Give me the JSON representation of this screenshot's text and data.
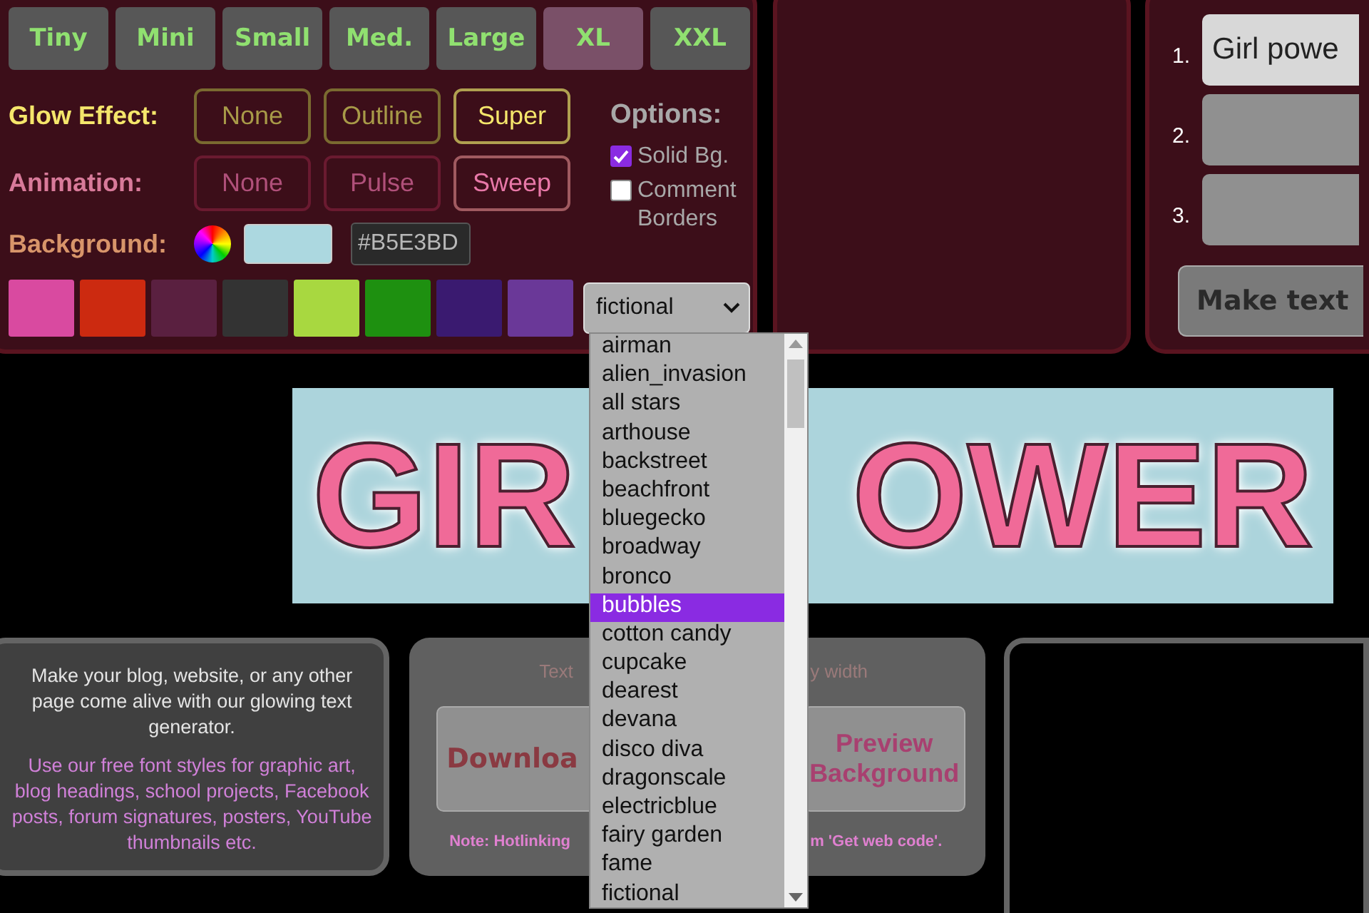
{
  "size_buttons": [
    {
      "label": "Tiny",
      "selected": false
    },
    {
      "label": "Mini",
      "selected": false
    },
    {
      "label": "Small",
      "selected": false
    },
    {
      "label": "Med.",
      "selected": false
    },
    {
      "label": "Large",
      "selected": false
    },
    {
      "label": "XL",
      "selected": true
    },
    {
      "label": "XXL",
      "selected": false
    }
  ],
  "glow_effect": {
    "label": "Glow Effect:",
    "options": [
      {
        "label": "None",
        "selected": false
      },
      {
        "label": "Outline",
        "selected": false
      },
      {
        "label": "Super",
        "selected": true
      }
    ]
  },
  "animation": {
    "label": "Animation:",
    "options": [
      {
        "label": "None",
        "selected": false
      },
      {
        "label": "Pulse",
        "selected": false
      },
      {
        "label": "Sweep",
        "selected": true
      }
    ]
  },
  "background": {
    "label": "Background:",
    "color": "#acd8e0",
    "hex_value": "#B5E3BD"
  },
  "options": {
    "label": "Options:",
    "items": [
      {
        "label": "Solid Bg.",
        "checked": true
      },
      {
        "label": "Comment Borders",
        "checked": false
      }
    ]
  },
  "swatches": [
    {
      "color": "#d94aa0"
    },
    {
      "color": "#cc2a10"
    },
    {
      "color": "#5a2040"
    },
    {
      "color": "#333333"
    },
    {
      "color": "#a8d840"
    },
    {
      "color": "#1e9010"
    },
    {
      "color": "#3a1a70"
    },
    {
      "color": "#6a3898"
    }
  ],
  "font_select": {
    "value": "fictional",
    "options": [
      {
        "label": "airman",
        "highlighted": false
      },
      {
        "label": "alien_invasion",
        "highlighted": false
      },
      {
        "label": "all stars",
        "highlighted": false
      },
      {
        "label": "arthouse",
        "highlighted": false
      },
      {
        "label": "backstreet",
        "highlighted": false
      },
      {
        "label": "beachfront",
        "highlighted": false
      },
      {
        "label": "bluegecko",
        "highlighted": false
      },
      {
        "label": "broadway",
        "highlighted": false
      },
      {
        "label": "bronco",
        "highlighted": false
      },
      {
        "label": "bubbles",
        "highlighted": true
      },
      {
        "label": "cotton candy",
        "highlighted": false
      },
      {
        "label": "cupcake",
        "highlighted": false
      },
      {
        "label": "dearest",
        "highlighted": false
      },
      {
        "label": "devana",
        "highlighted": false
      },
      {
        "label": "disco diva",
        "highlighted": false
      },
      {
        "label": "dragonscale",
        "highlighted": false
      },
      {
        "label": "electricblue",
        "highlighted": false
      },
      {
        "label": "fairy garden",
        "highlighted": false
      },
      {
        "label": "fame",
        "highlighted": false
      },
      {
        "label": "fictional",
        "highlighted": false
      }
    ]
  },
  "text_lines": [
    {
      "number": "1.",
      "value": "Girl powe"
    },
    {
      "number": "2."
    },
    {
      "number": "3."
    }
  ],
  "make_text_button": "Make text",
  "banner": {
    "left_text": "GIR",
    "right_text": "OWER"
  },
  "intro": {
    "paragraph_1": "Make your blog, website, or any other page come alive with our glowing text generator.",
    "paragraph_2": "Use our free font styles for graphic art, blog headings, school projects, Facebook posts, forum signatures, posters, YouTube thumbnails etc."
  },
  "download_panel": {
    "caption_left": "Text",
    "caption_right": "y width",
    "download_button": "Downloa",
    "preview_button": "Preview Background",
    "note_left": "Note: Hotlinking",
    "note_right": "m 'Get web code'."
  }
}
